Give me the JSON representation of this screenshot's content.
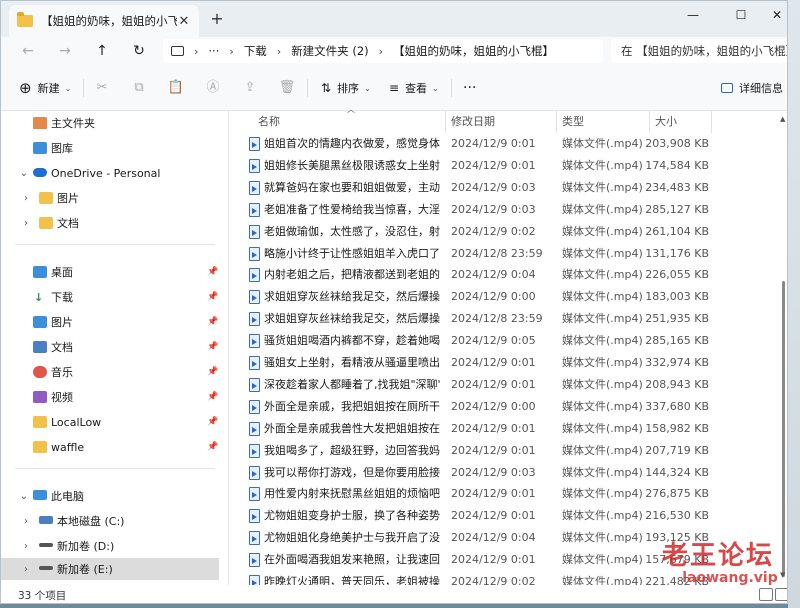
{
  "window": {
    "tab_title": "【姐姐的奶味，姐姐的小飞棍】",
    "tab_close": "✕",
    "new_tab": "+",
    "minimize": "—",
    "maximize": "☐",
    "close": "✕"
  },
  "nav": {
    "back": "←",
    "forward": "→",
    "up": "↑",
    "refresh": "↻",
    "more": "···",
    "breadcrumbs": [
      "下载",
      "新建文件夹 (2)",
      "【姐姐的奶味，姐姐的小飞棍】"
    ],
    "search_text": "在 【姐姐的奶味，姐姐的小飞棍】"
  },
  "commands": {
    "new_label": "新建",
    "sort_label": "排序",
    "view_label": "查看",
    "more": "···",
    "details_label": "详细信息"
  },
  "sidebar": {
    "home": "主文件夹",
    "gallery": "图库",
    "onedrive": "OneDrive - Personal",
    "od_pictures": "图片",
    "od_docs": "文档",
    "desktop": "桌面",
    "downloads": "下载",
    "pictures": "图片",
    "documents": "文档",
    "music": "音乐",
    "videos": "视频",
    "locallow": "LocalLow",
    "waffle": "waffle",
    "thispc": "此电脑",
    "drive_c": "本地磁盘 (C:)",
    "drive_d": "新加卷 (D:)",
    "drive_e": "新加卷 (E:)"
  },
  "columns": {
    "name": "名称",
    "date": "修改日期",
    "type": "类型",
    "size": "大小"
  },
  "files": [
    {
      "name": "姐姐首次的情趣内衣做爱，感觉身体被掏",
      "date": "2024/12/9 0:01",
      "type": "媒体文件(.mp4)",
      "size": "203,908 KB"
    },
    {
      "name": "姐姐修长美腿黑丝极限诱惑女上坐射看精",
      "date": "2024/12/9 0:01",
      "type": "媒体文件(.mp4)",
      "size": "174,584 KB"
    },
    {
      "name": "就算爸妈在家也要和姐姐做爱，主动穿上",
      "date": "2024/12/9 0:03",
      "type": "媒体文件(.mp4)",
      "size": "234,483 KB"
    },
    {
      "name": "老姐准备了性爱椅给我当惊喜，大淫屄流",
      "date": "2024/12/9 0:03",
      "type": "媒体文件(.mp4)",
      "size": "285,127 KB"
    },
    {
      "name": "老姐做瑜伽，太性感了，没忍住，射满姐",
      "date": "2024/12/9 0:02",
      "type": "媒体文件(.mp4)",
      "size": "261,104 KB"
    },
    {
      "name": "略施小计终于让性感姐姐羊入虎口了小穴",
      "date": "2024/12/8 23:59",
      "type": "媒体文件(.mp4)",
      "size": "131,176 KB"
    },
    {
      "name": "内射老姐之后，把精液都送到老姐的屁眼",
      "date": "2024/12/9 0:04",
      "type": "媒体文件(.mp4)",
      "size": "226,055 KB"
    },
    {
      "name": "求姐姐穿灰丝袜给我足交，然后爆操后入",
      "date": "2024/12/9 0:00",
      "type": "媒体文件(.mp4)",
      "size": "183,003 KB"
    },
    {
      "name": "求姐姐穿灰丝袜给我足交，然后爆操内射",
      "date": "2024/12/8 23:59",
      "type": "媒体文件(.mp4)",
      "size": "251,935 KB"
    },
    {
      "name": "骚货姐姐喝酒内裤都不穿，趁着她喝多把",
      "date": "2024/12/9 0:05",
      "type": "媒体文件(.mp4)",
      "size": "285,165 KB"
    },
    {
      "name": "骚姐女上坐射，看精液从骚逼里喷出来 [",
      "date": "2024/12/9 0:01",
      "type": "媒体文件(.mp4)",
      "size": "332,974 KB"
    },
    {
      "name": "深夜趁着家人都睡着了,找我姐\"深聊\"，情",
      "date": "2024/12/9 0:01",
      "type": "媒体文件(.mp4)",
      "size": "208,943 KB"
    },
    {
      "name": "外面全是亲戚，我把姐姐按在厕所干屁眼",
      "date": "2024/12/9 0:00",
      "type": "媒体文件(.mp4)",
      "size": "337,680 KB"
    },
    {
      "name": "外面全是亲戚我兽性大发把姐姐按在厕所",
      "date": "2024/12/9 0:01",
      "type": "媒体文件(.mp4)",
      "size": "158,982 KB"
    },
    {
      "name": "我姐喝多了，超级狂野，边回答我妈边给",
      "date": "2024/12/9 0:01",
      "type": "媒体文件(.mp4)",
      "size": "207,719 KB"
    },
    {
      "name": "我可以帮你打游戏，但是你要用脸接着我",
      "date": "2024/12/9 0:03",
      "type": "媒体文件(.mp4)",
      "size": "144,324 KB"
    },
    {
      "name": "用性爱内射来抚慰黑丝姐姐的烦恼吧！！[",
      "date": "2024/12/9 0:01",
      "type": "媒体文件(.mp4)",
      "size": "276,875 KB"
    },
    {
      "name": "尤物姐姐变身护士服，换了各种姿势后终",
      "date": "2024/12/9 0:01",
      "type": "媒体文件(.mp4)",
      "size": "216,530 KB"
    },
    {
      "name": "尤物姐姐化身绝美护士与我开启了没羞没",
      "date": "2024/12/9 0:04",
      "type": "媒体文件(.mp4)",
      "size": "193,125 KB"
    },
    {
      "name": "在外面喝酒我姐发来艳照，让我速回内射",
      "date": "2024/12/9 0:01",
      "type": "媒体文件(.mp4)",
      "size": "157,679 KB"
    },
    {
      "name": "昨晚灯火通明，普天同乐，老姐被操得骚",
      "date": "2024/12/9 0:02",
      "type": "媒体文件(.mp4)",
      "size": "221,482 KB"
    }
  ],
  "status": {
    "count": "33 个项目"
  },
  "watermark": {
    "main": "老王论坛",
    "sub": "laowang.vip"
  },
  "colors": {
    "accent": "#2b66c4",
    "folder": "#f2c14a",
    "watermark": "#d22828"
  }
}
